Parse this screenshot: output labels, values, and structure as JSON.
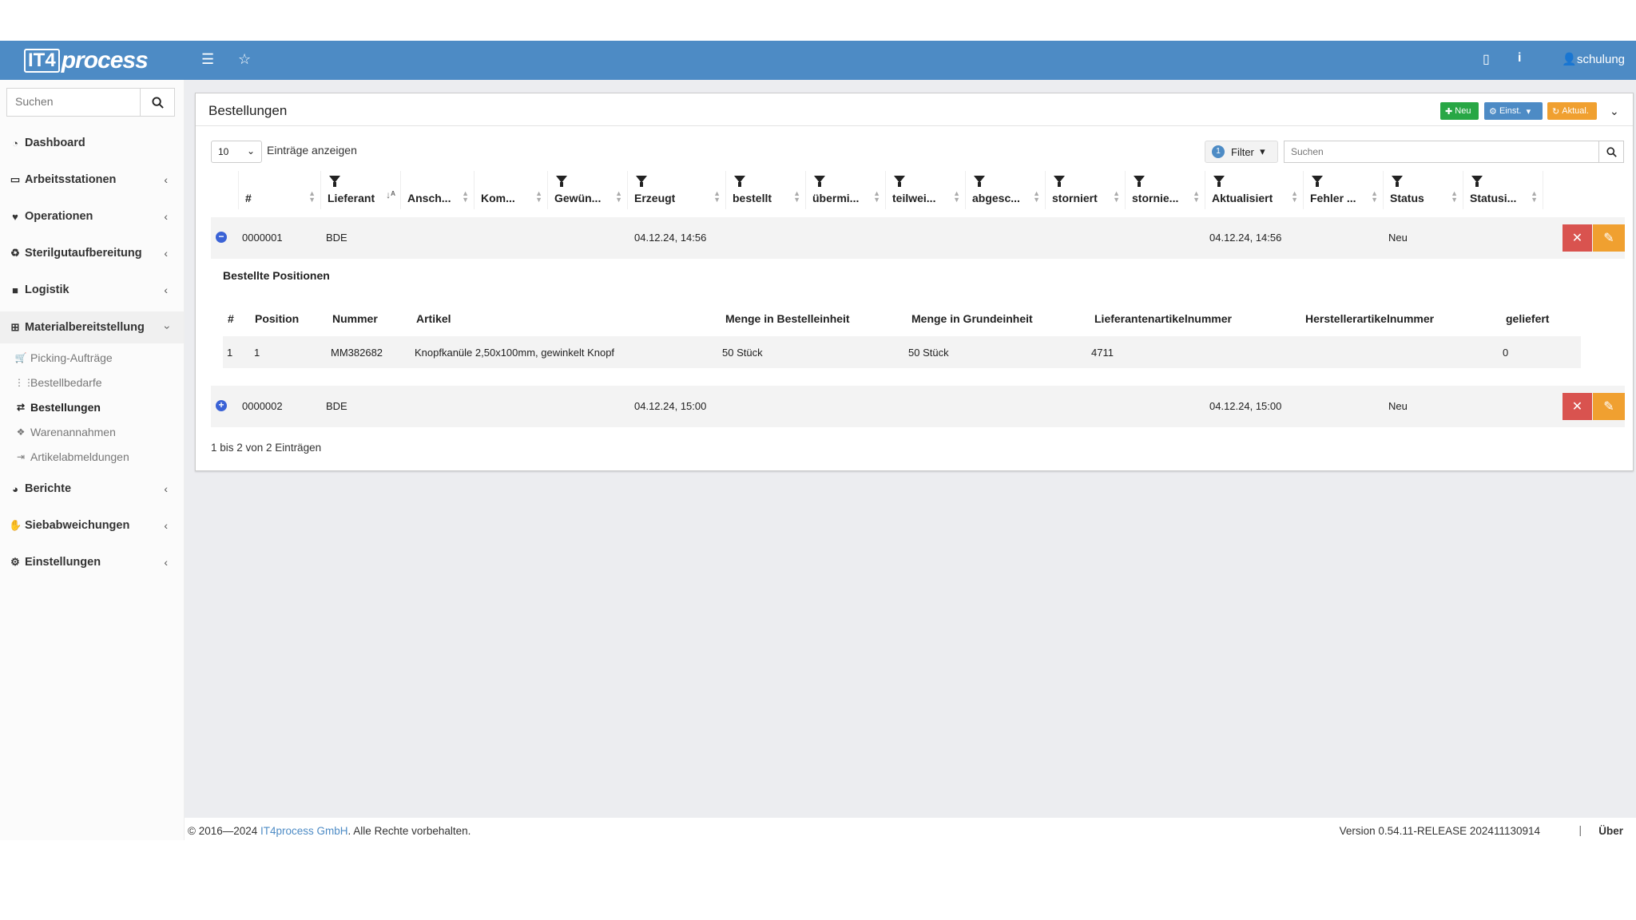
{
  "brand": {
    "logo_box": "IT4",
    "logo_text": "process"
  },
  "topbar": {
    "user": "schulung"
  },
  "sidebar": {
    "search_placeholder": "Suchen",
    "items": [
      {
        "label": "Dashboard"
      },
      {
        "label": "Arbeitsstationen"
      },
      {
        "label": "Operationen"
      },
      {
        "label": "Sterilgutaufbereitung"
      },
      {
        "label": "Logistik"
      },
      {
        "label": "Materialbereitstellung"
      },
      {
        "label": "Berichte"
      },
      {
        "label": "Siebabweichungen"
      },
      {
        "label": "Einstellungen"
      }
    ],
    "sub_items": [
      {
        "label": "Picking-Aufträge"
      },
      {
        "label": "Bestellbedarfe"
      },
      {
        "label": "Bestellungen"
      },
      {
        "label": "Warenannahmen"
      },
      {
        "label": "Artikelabmeldungen"
      }
    ]
  },
  "card": {
    "title": "Bestellungen",
    "btn_new": "Neu",
    "btn_settings": "Einst.",
    "btn_refresh": "Aktual."
  },
  "table_controls": {
    "page_length": "10",
    "length_label": "Einträge anzeigen",
    "filter_count": "1",
    "filter_label": "Filter",
    "search_placeholder": "Suchen"
  },
  "columns": [
    "#",
    "Lieferant",
    "Ansch...",
    "Kom...",
    "Gewün...",
    "Erzeugt",
    "bestellt",
    "übermi...",
    "teilwei...",
    "abgesc...",
    "storniert",
    "stornie...",
    "Aktualisiert",
    "Fehler ...",
    "Status",
    "Statusi..."
  ],
  "rows": [
    {
      "num": "0000001",
      "supplier": "BDE",
      "created": "04.12.24, 14:56",
      "updated": "04.12.24, 14:56",
      "status": "Neu"
    },
    {
      "num": "0000002",
      "supplier": "BDE",
      "created": "04.12.24, 15:00",
      "updated": "04.12.24, 15:00",
      "status": "Neu"
    }
  ],
  "detail": {
    "title": "Bestellte Positionen",
    "columns": [
      "#",
      "Position",
      "Nummer",
      "Artikel",
      "Menge in Bestelleinheit",
      "Menge in Grundeinheit",
      "Lieferantenartikelnummer",
      "Herstellerartikelnummer",
      "geliefert"
    ],
    "rows": [
      {
        "idx": "1",
        "position": "1",
        "number": "MM382682",
        "article": "Knopfkanüle 2,50x100mm, gewinkelt Knopf",
        "qty_order": "50 Stück",
        "qty_base": "50 Stück",
        "supplier_art": "4711",
        "maker_art": "",
        "delivered": "0"
      }
    ]
  },
  "info": "1 bis 2 von 2 Einträgen",
  "footer": {
    "copyright_prefix": "© 2016—2024 ",
    "company": "IT4process GmbH",
    "copyright_suffix": ". Alle Rechte vorbehalten.",
    "version": "Version 0.54.11-RELEASE 202411130914",
    "separator": "|",
    "about": "Über"
  },
  "colors": {
    "topbar": "#4d8bc5",
    "new": "#28a745",
    "settings": "#4d8bc5",
    "refresh": "#f0a030",
    "delete": "#d9534f",
    "edit": "#f0a030"
  }
}
